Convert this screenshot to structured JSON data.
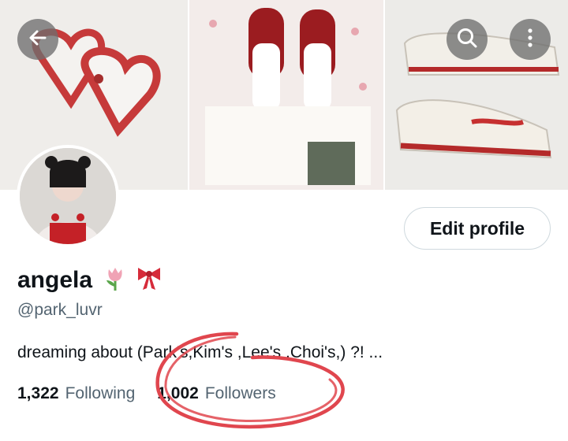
{
  "header": {
    "back_icon": "arrow-left-icon",
    "search_icon": "search-icon",
    "more_icon": "more-vertical-icon"
  },
  "profile": {
    "display_name": "angela",
    "name_emojis": [
      "tulip-icon",
      "ribbon-icon"
    ],
    "handle": "@park_luvr",
    "bio": "dreaming about (Park's,Kim's ,Lee's ,Choi's,) ?! ...",
    "edit_button_label": "Edit profile"
  },
  "stats": {
    "following_count": "1,322",
    "following_label": "Following",
    "followers_count": "1,002",
    "followers_label": "Followers"
  },
  "colors": {
    "text_primary": "#0f1419",
    "text_secondary": "#536471",
    "annotation_red": "#e0464e"
  }
}
